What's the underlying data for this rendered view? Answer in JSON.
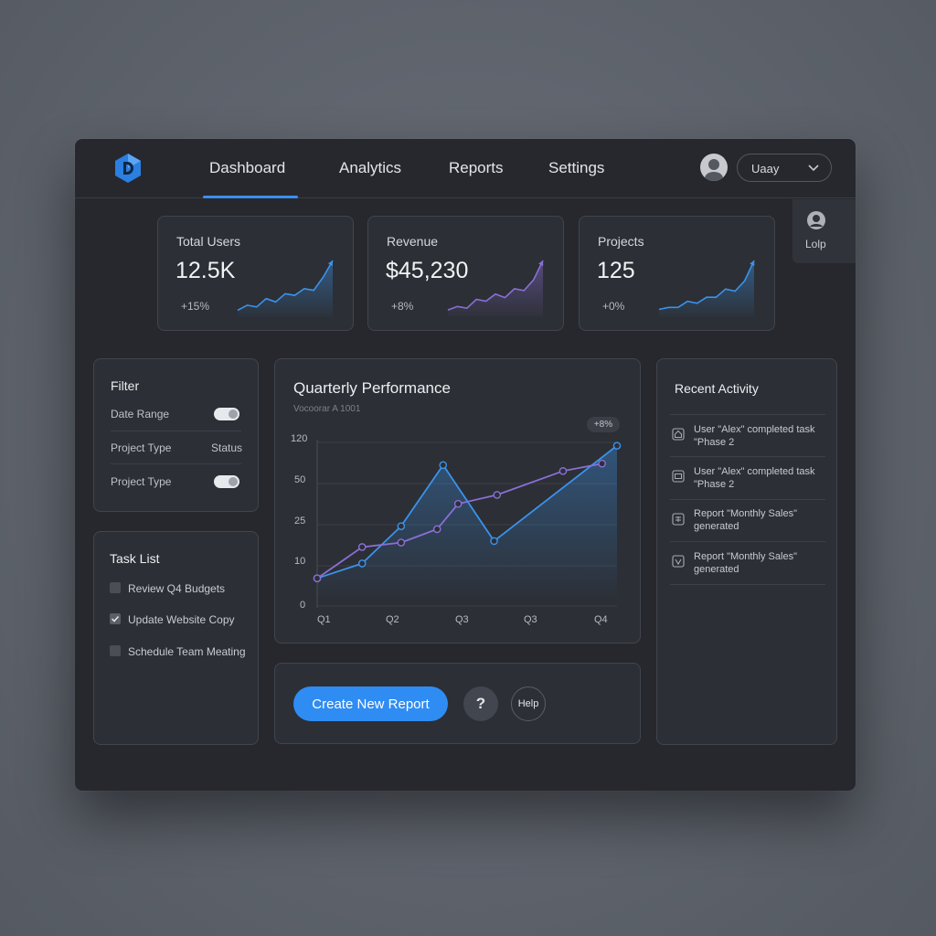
{
  "nav": {
    "items": [
      {
        "label": "Dashboard",
        "active": true
      },
      {
        "label": "Analytics"
      },
      {
        "label": "Reports"
      },
      {
        "label": "Settings"
      }
    ],
    "user_select_value": "Uaay",
    "help_tab_label": "Lolp"
  },
  "stats": [
    {
      "label": "Total Users",
      "value": "12.5K",
      "delta": "+15%",
      "spark": [
        2,
        5,
        4,
        9,
        7,
        12,
        11,
        15,
        14,
        22,
        32
      ]
    },
    {
      "label": "Revenue",
      "value": "$45,230",
      "delta": "+8%",
      "spark": [
        2,
        4,
        3,
        8,
        7,
        11,
        9,
        14,
        13,
        19,
        30
      ]
    },
    {
      "label": "Projects",
      "value": "125",
      "delta": "+0%",
      "spark": [
        2,
        3,
        3,
        6,
        5,
        8,
        8,
        12,
        11,
        16,
        26
      ]
    }
  ],
  "filter": {
    "title": "Filter",
    "rows": [
      {
        "label": "Date Range",
        "control": "toggle"
      },
      {
        "label": "Project Type",
        "control": "text",
        "value": "Status"
      },
      {
        "label": "Project Type",
        "control": "toggle"
      }
    ]
  },
  "tasks": {
    "title": "Task List",
    "items": [
      {
        "label": "Review Q4 Budgets",
        "checked": false
      },
      {
        "label": "Update Website Copy",
        "checked": true
      },
      {
        "label": "Schedule Team Meating",
        "checked": false
      }
    ]
  },
  "chart_data": {
    "type": "line",
    "title": "Quarterly Performance",
    "subtitle": "Vocoorar A 1001",
    "badge": "+8%",
    "yticks": [
      "120",
      "50",
      "25",
      "10",
      "0"
    ],
    "xticks": [
      "Q1",
      "Q2",
      "Q3",
      "Q3",
      "Q4"
    ],
    "grid": true,
    "series": [
      {
        "color": "#3a93ec",
        "points": [
          [
            0,
            0.1
          ],
          [
            0.15,
            0.2
          ],
          [
            0.28,
            0.45
          ],
          [
            0.42,
            0.86
          ],
          [
            0.59,
            0.35
          ],
          [
            1.0,
            0.99
          ]
        ]
      },
      {
        "color": "#8a6fd6",
        "points": [
          [
            0,
            0.1
          ],
          [
            0.15,
            0.31
          ],
          [
            0.28,
            0.34
          ],
          [
            0.4,
            0.43
          ],
          [
            0.47,
            0.6
          ],
          [
            0.6,
            0.66
          ],
          [
            0.82,
            0.82
          ],
          [
            0.95,
            0.87
          ]
        ]
      }
    ]
  },
  "actions": {
    "create_label": "Create New Report",
    "question_label": "?",
    "help_label": "Help"
  },
  "activity": {
    "title": "Recent Activity",
    "items": [
      {
        "icon": "home-icon",
        "text": "User \"Alex\" completed task \"Phase 2"
      },
      {
        "icon": "calendar-icon",
        "text": "User \"Alex\" completed task \"Phase 2"
      },
      {
        "icon": "report-icon",
        "text": "Report \"Monthly Sales\" generated"
      },
      {
        "icon": "check-shield-icon",
        "text": "Report \"Monthly Sales\" generated"
      }
    ]
  },
  "colors": {
    "accent": "#2f8cf3",
    "line_primary": "#3a93ec",
    "line_secondary": "#8a6fd6",
    "panel": "#2c2f35",
    "window": "#26282e"
  }
}
